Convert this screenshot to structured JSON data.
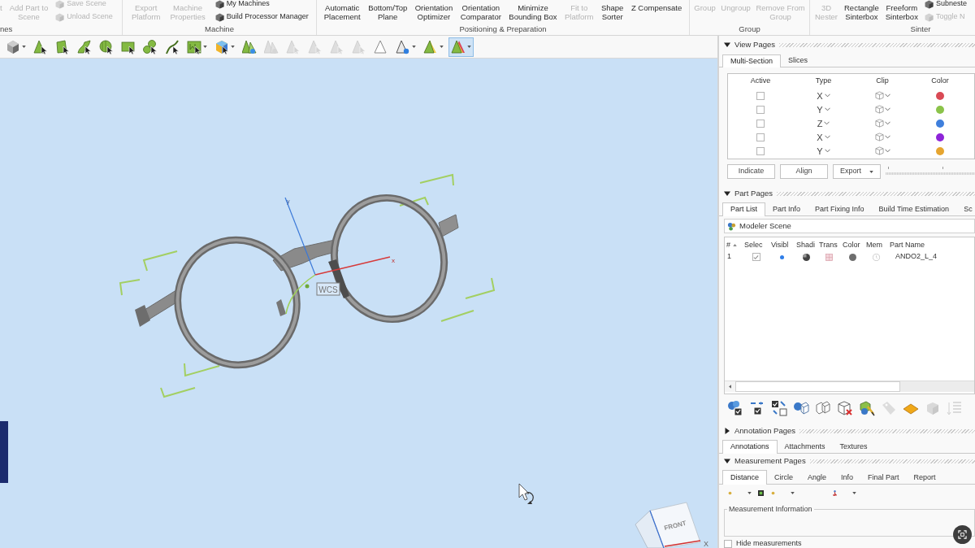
{
  "ribbon": {
    "groups": [
      {
        "label": "nes",
        "commands": [
          {
            "kind": "large",
            "label": "t",
            "disabled": true
          },
          {
            "kind": "large",
            "label": "Add Part to\nScene",
            "disabled": true
          },
          {
            "kind": "small",
            "label": "Save Scene",
            "disabled": true
          },
          {
            "kind": "small",
            "label": "Unload Scene",
            "disabled": true
          }
        ]
      },
      {
        "label": "Machine",
        "commands": [
          {
            "kind": "large",
            "label": "Export\nPlatform",
            "disabled": true
          },
          {
            "kind": "large",
            "label": "Machine\nProperties",
            "disabled": true
          },
          {
            "kind": "small",
            "label": "My Machines",
            "disabled": false
          },
          {
            "kind": "small",
            "label": "Build Processor Manager",
            "disabled": false
          }
        ]
      },
      {
        "label": "Positioning & Preparation",
        "commands": [
          {
            "kind": "large",
            "label": "Automatic\nPlacement",
            "disabled": false
          },
          {
            "kind": "large",
            "label": "Bottom/Top\nPlane",
            "disabled": false
          },
          {
            "kind": "large",
            "label": "Orientation\nOptimizer",
            "disabled": false
          },
          {
            "kind": "large",
            "label": "Orientation\nComparator",
            "disabled": false
          },
          {
            "kind": "large",
            "label": "Minimize\nBounding Box",
            "disabled": false
          },
          {
            "kind": "large",
            "label": "Fit to\nPlatform",
            "disabled": true
          },
          {
            "kind": "large",
            "label": "Shape\nSorter",
            "disabled": false
          },
          {
            "kind": "large",
            "label": "Z Compensate",
            "disabled": false
          }
        ]
      },
      {
        "label": "Group",
        "commands": [
          {
            "kind": "large",
            "label": "Group",
            "disabled": true
          },
          {
            "kind": "large",
            "label": "Ungroup",
            "disabled": true
          },
          {
            "kind": "large",
            "label": "Remove From\nGroup",
            "disabled": true
          }
        ]
      },
      {
        "label": "Sinter",
        "commands": [
          {
            "kind": "large",
            "label": "3D\nNester",
            "disabled": true
          },
          {
            "kind": "large",
            "label": "Rectangle\nSinterbox",
            "disabled": false
          },
          {
            "kind": "large",
            "label": "Freeform\nSinterbox",
            "disabled": false
          },
          {
            "kind": "small",
            "label": "Subneste",
            "disabled": false
          },
          {
            "kind": "small",
            "label": "Toggle N",
            "disabled": true
          }
        ]
      }
    ]
  },
  "toolbar": [
    {
      "kind": "cube",
      "menu": true,
      "disabled": false,
      "selected": false
    },
    {
      "kind": "triangle",
      "menu": false,
      "disabled": false,
      "selected": false
    },
    {
      "kind": "quad",
      "menu": false,
      "disabled": false,
      "selected": false
    },
    {
      "kind": "curve",
      "menu": false,
      "disabled": false,
      "selected": false
    },
    {
      "kind": "sphere",
      "menu": false,
      "disabled": false,
      "selected": false
    },
    {
      "kind": "rect",
      "menu": false,
      "disabled": false,
      "selected": false
    },
    {
      "kind": "blobs",
      "menu": false,
      "disabled": false,
      "selected": false
    },
    {
      "kind": "line",
      "menu": false,
      "disabled": false,
      "selected": false
    },
    {
      "kind": "box",
      "menu": true,
      "disabled": false,
      "selected": false
    },
    {
      "kind": "color-cube",
      "menu": true,
      "disabled": false,
      "selected": false
    },
    {
      "kind": "triangle-pair",
      "menu": false,
      "disabled": false,
      "selected": false
    },
    {
      "kind": "triangle-pair",
      "menu": false,
      "disabled": true,
      "selected": false
    },
    {
      "kind": "triangle",
      "menu": false,
      "disabled": true,
      "selected": false
    },
    {
      "kind": "triangle",
      "menu": false,
      "disabled": true,
      "selected": false
    },
    {
      "kind": "triangle",
      "menu": false,
      "disabled": true,
      "selected": false
    },
    {
      "kind": "triangle",
      "menu": false,
      "disabled": true,
      "selected": false
    },
    {
      "kind": "triangle-outline",
      "menu": false,
      "disabled": false,
      "selected": false
    },
    {
      "kind": "triangle-blue",
      "menu": true,
      "disabled": false,
      "selected": false
    },
    {
      "kind": "triangle-yellow",
      "menu": true,
      "disabled": false,
      "selected": false
    },
    {
      "kind": "triangle-red",
      "menu": true,
      "disabled": false,
      "selected": true
    }
  ],
  "viewport": {
    "y_axis_label": "y",
    "x_axis_label": "x",
    "wcs_label": "WCS",
    "view_cube_face": "FRONT",
    "triad_label": "X"
  },
  "view_pages": {
    "title": "View Pages",
    "expanded": true,
    "tabs": [
      {
        "label": "Multi-Section",
        "selected": true
      },
      {
        "label": "Slices",
        "selected": false
      }
    ],
    "table": {
      "columns": [
        "Active",
        "Type",
        "Clip",
        "Color"
      ],
      "rows": [
        {
          "active": false,
          "type": "X",
          "color": "#d94a55"
        },
        {
          "active": false,
          "type": "Y",
          "color": "#8bc34a"
        },
        {
          "active": false,
          "type": "Z",
          "color": "#3f7fdc"
        },
        {
          "active": false,
          "type": "X",
          "color": "#8e24d8"
        },
        {
          "active": false,
          "type": "Y",
          "color": "#e6a530"
        }
      ]
    },
    "buttons": [
      {
        "label": "Indicate",
        "menu": false
      },
      {
        "label": "Align",
        "menu": false
      },
      {
        "label": "Export",
        "menu": true
      }
    ]
  },
  "part_pages": {
    "title": "Part Pages",
    "expanded": true,
    "tabs": [
      {
        "label": "Part List",
        "selected": true
      },
      {
        "label": "Part Info",
        "selected": false
      },
      {
        "label": "Part Fixing Info",
        "selected": false
      },
      {
        "label": "Build Time Estimation",
        "selected": false
      },
      {
        "label": "Sc",
        "selected": false
      }
    ],
    "scene": "Modeler Scene",
    "table": {
      "columns": [
        "#",
        "Selec",
        "Visibl",
        "Shadi",
        "Trans",
        "Color",
        "Mem",
        "Part Name"
      ],
      "rows": [
        {
          "number": "1",
          "selected": true,
          "visible": true,
          "color": "#6e6e6e",
          "name": "ANDO2_L_4"
        }
      ]
    },
    "tools": [
      {
        "kind": "parts-check",
        "disabled": false
      },
      {
        "kind": "swap-check",
        "disabled": false
      },
      {
        "kind": "select-toggle",
        "disabled": false
      },
      {
        "kind": "cubes",
        "disabled": false
      },
      {
        "kind": "cubes-outline",
        "disabled": false
      },
      {
        "kind": "cube-delete",
        "disabled": false
      },
      {
        "kind": "paint",
        "disabled": false
      },
      {
        "kind": "tag",
        "disabled": true
      },
      {
        "kind": "plate",
        "disabled": false
      },
      {
        "kind": "box",
        "disabled": true
      },
      {
        "kind": "list",
        "disabled": true
      }
    ]
  },
  "annotation_pages": {
    "title": "Annotation Pages",
    "expanded": false,
    "tabs": [
      {
        "label": "Annotations",
        "selected": true
      },
      {
        "label": "Attachments",
        "selected": false
      },
      {
        "label": "Textures",
        "selected": false
      }
    ]
  },
  "measurement_pages": {
    "title": "Measurement Pages",
    "expanded": true,
    "tabs": [
      {
        "label": "Distance",
        "selected": true
      },
      {
        "label": "Circle",
        "selected": false
      },
      {
        "label": "Angle",
        "selected": false
      },
      {
        "label": "Info",
        "selected": false
      },
      {
        "label": "Final Part",
        "selected": false
      },
      {
        "label": "Report",
        "selected": false
      }
    ],
    "tools": [
      {
        "kind": "point",
        "menu": true
      },
      {
        "kind": "square",
        "menu": false
      },
      {
        "kind": "point",
        "menu": true
      },
      {
        "kind": "figure",
        "menu": true
      }
    ],
    "info_title": "Measurement Information",
    "hide_measurements": {
      "label": "Hide measurements",
      "checked": false
    }
  }
}
